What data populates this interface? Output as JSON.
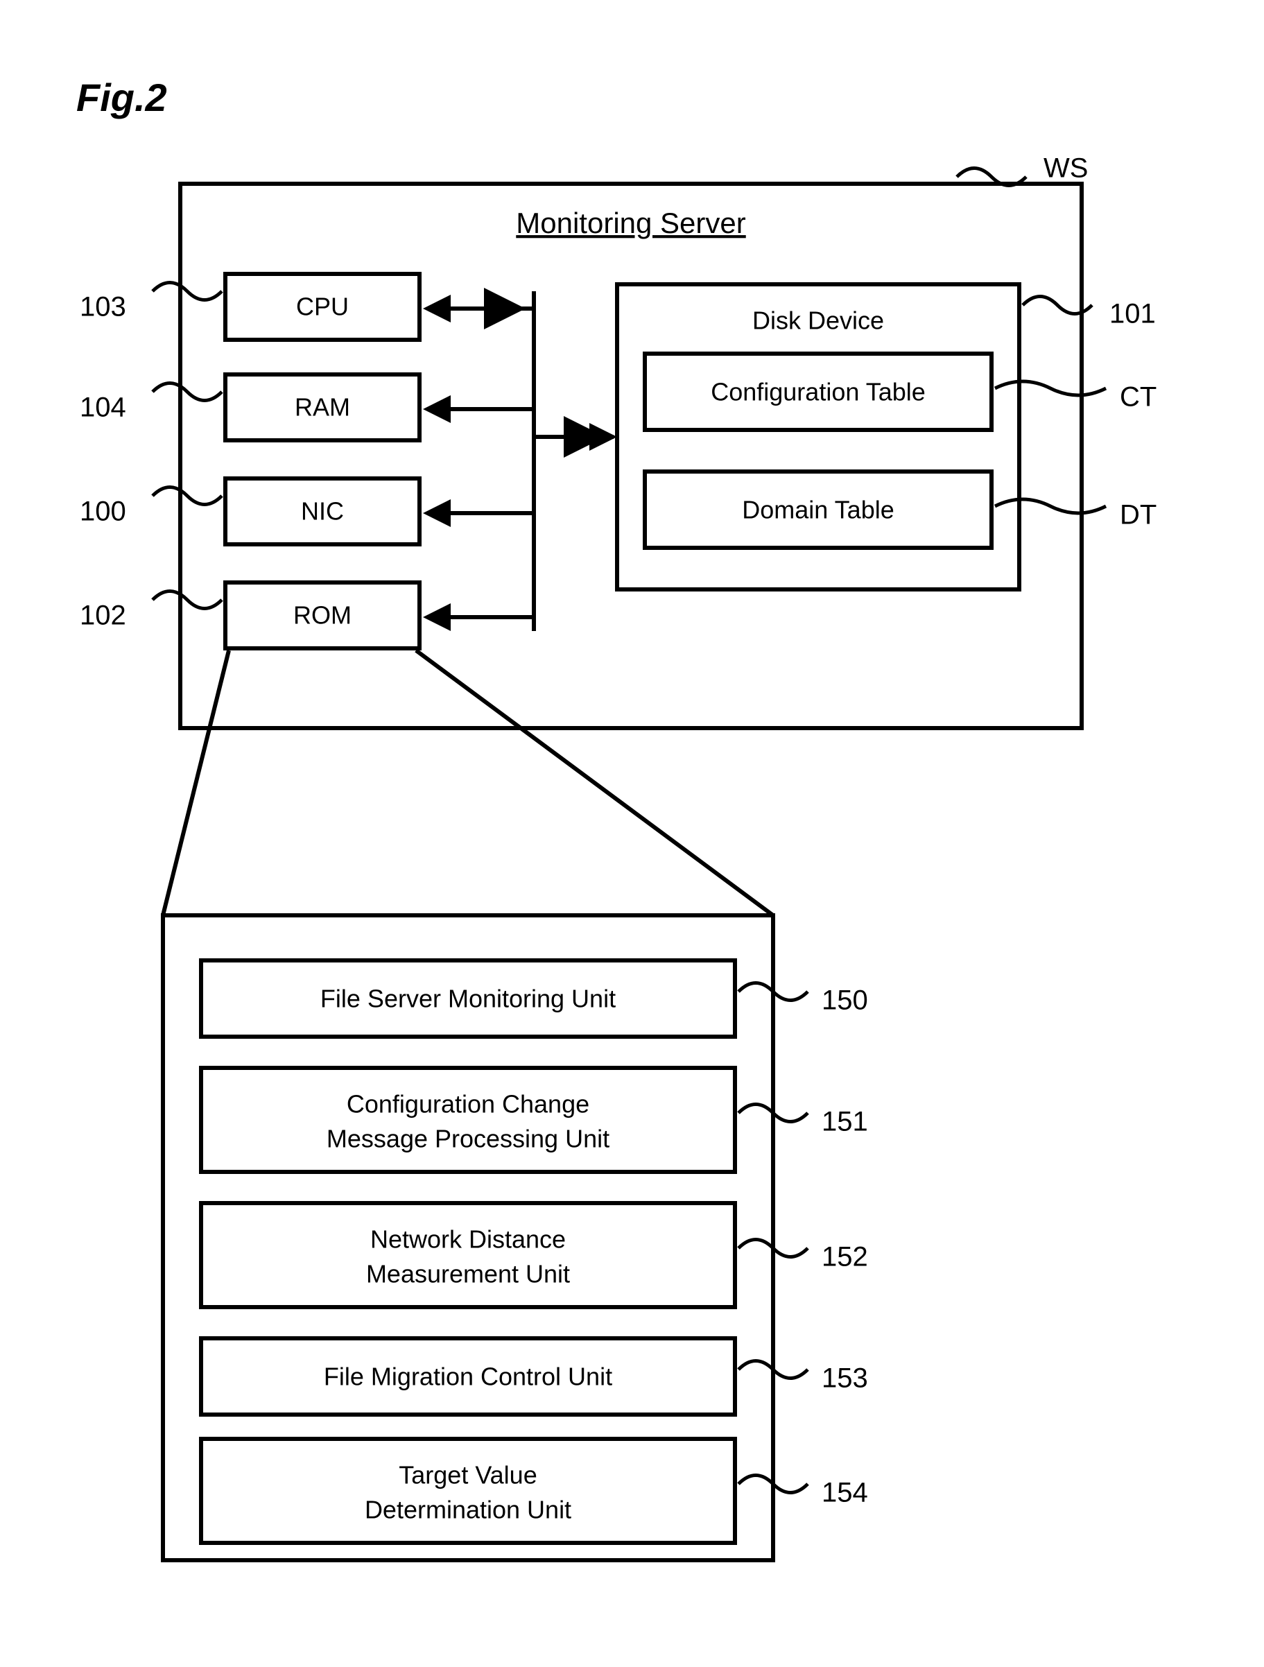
{
  "figure_label": "Fig.2",
  "monitoring_server": {
    "title": "Monitoring Server",
    "ref": "WS",
    "components": {
      "cpu": {
        "label": "CPU",
        "ref": "103"
      },
      "ram": {
        "label": "RAM",
        "ref": "104"
      },
      "nic": {
        "label": "NIC",
        "ref": "100"
      },
      "rom": {
        "label": "ROM",
        "ref": "102"
      }
    },
    "disk_device": {
      "label": "Disk Device",
      "ref": "101",
      "configuration_table": {
        "label": "Configuration Table",
        "ref": "CT"
      },
      "domain_table": {
        "label": "Domain Table",
        "ref": "DT"
      }
    }
  },
  "rom_contents": {
    "units": [
      {
        "label1": "File Server Monitoring Unit",
        "ref": "150"
      },
      {
        "label1": "Configuration Change",
        "label2": "Message Processing Unit",
        "ref": "151"
      },
      {
        "label1": "Network Distance",
        "label2": "Measurement Unit",
        "ref": "152"
      },
      {
        "label1": "File Migration Control Unit",
        "ref": "153"
      },
      {
        "label1": "Target Value",
        "label2": "Determination Unit",
        "ref": "154"
      }
    ]
  }
}
